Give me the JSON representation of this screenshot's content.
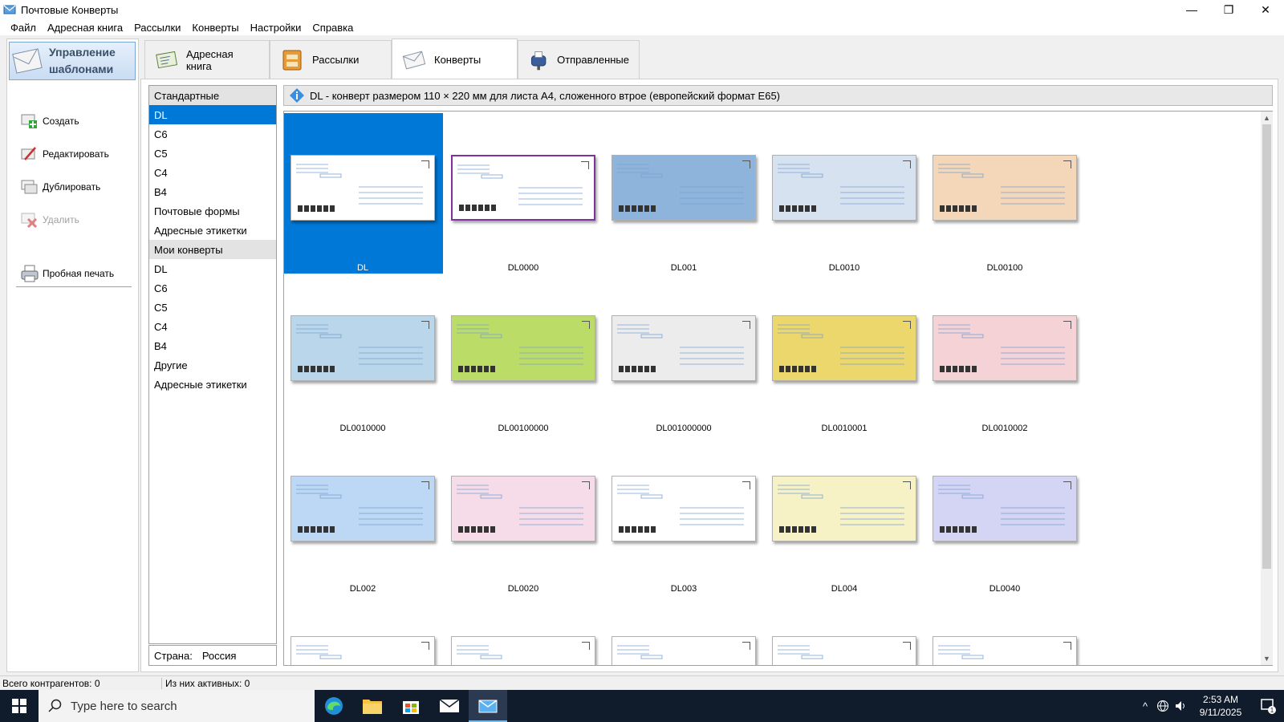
{
  "window": {
    "title": "Почтовые Конверты",
    "minimize": "—",
    "restore": "❐",
    "close": "✕"
  },
  "menu": [
    "Файл",
    "Адресная книга",
    "Рассылки",
    "Конверты",
    "Настройки",
    "Справка"
  ],
  "left_panel": {
    "header_line1": "Управление",
    "header_line2": "шаблонами",
    "actions": [
      {
        "label": "Создать",
        "icon": "create-icon",
        "enabled": true
      },
      {
        "label": "Редактировать",
        "icon": "edit-icon",
        "enabled": true
      },
      {
        "label": "Дублировать",
        "icon": "duplicate-icon",
        "enabled": true
      },
      {
        "label": "Удалить",
        "icon": "delete-icon",
        "enabled": false
      }
    ],
    "print_label": "Пробная печать"
  },
  "tabs": [
    {
      "label": "Адресная книга",
      "active": false
    },
    {
      "label": "Рассылки",
      "active": false
    },
    {
      "label": "Конверты",
      "active": true
    },
    {
      "label": "Отправленные",
      "active": false
    }
  ],
  "categories": {
    "standard_header": "Стандартные",
    "standard": [
      "DL",
      "C6",
      "C5",
      "C4",
      "B4",
      "Почтовые формы",
      "Адресные этикетки"
    ],
    "my_header": "Мои конверты",
    "my": [
      "DL",
      "C6",
      "C5",
      "C4",
      "B4",
      "Другие",
      "Адресные этикетки"
    ],
    "selected": "DL"
  },
  "country": {
    "label": "Страна:",
    "value": "Россия"
  },
  "info_text": "DL - конверт размером 110 × 220 мм для листа A4, сложенного втрое (европейский формат E65)",
  "envelopes": [
    {
      "name": "DL",
      "bg": "#ffffff",
      "selected": true
    },
    {
      "name": "DL0000",
      "bg": "#ffffff",
      "border": "#8030a0"
    },
    {
      "name": "DL001",
      "bg": "#8fb4dc"
    },
    {
      "name": "DL0010",
      "bg": "#d6e2f0"
    },
    {
      "name": "DL00100",
      "bg": "#f4d7b8"
    },
    {
      "name": "DL0010000",
      "bg": "#b9d6ea"
    },
    {
      "name": "DL00100000",
      "bg": "#bcdc68"
    },
    {
      "name": "DL001000000",
      "bg": "#ececec"
    },
    {
      "name": "DL0010001",
      "bg": "#ecd76c"
    },
    {
      "name": "DL0010002",
      "bg": "#f4d2d6"
    },
    {
      "name": "DL002",
      "bg": "#bcd8f4"
    },
    {
      "name": "DL0020",
      "bg": "#f6dce8"
    },
    {
      "name": "DL003",
      "bg": "#ffffff"
    },
    {
      "name": "DL004",
      "bg": "#f6f2c6"
    },
    {
      "name": "DL0040",
      "bg": "#d4d4f4"
    },
    {
      "name": "",
      "bg": "#ffffff"
    },
    {
      "name": "",
      "bg": "#ffffff"
    },
    {
      "name": "",
      "bg": "#ffffff"
    },
    {
      "name": "",
      "bg": "#ffffff"
    },
    {
      "name": "",
      "bg": "#ffffff"
    }
  ],
  "status": {
    "total": "Всего контрагентов: 0",
    "active": "Из них активных: 0"
  },
  "taskbar": {
    "search_placeholder": "Type here to search",
    "time": "2:53 AM",
    "date": "9/11/2025",
    "notifications": "1"
  },
  "colors": {
    "accent": "#0078d7",
    "taskbar": "#101c2c"
  }
}
